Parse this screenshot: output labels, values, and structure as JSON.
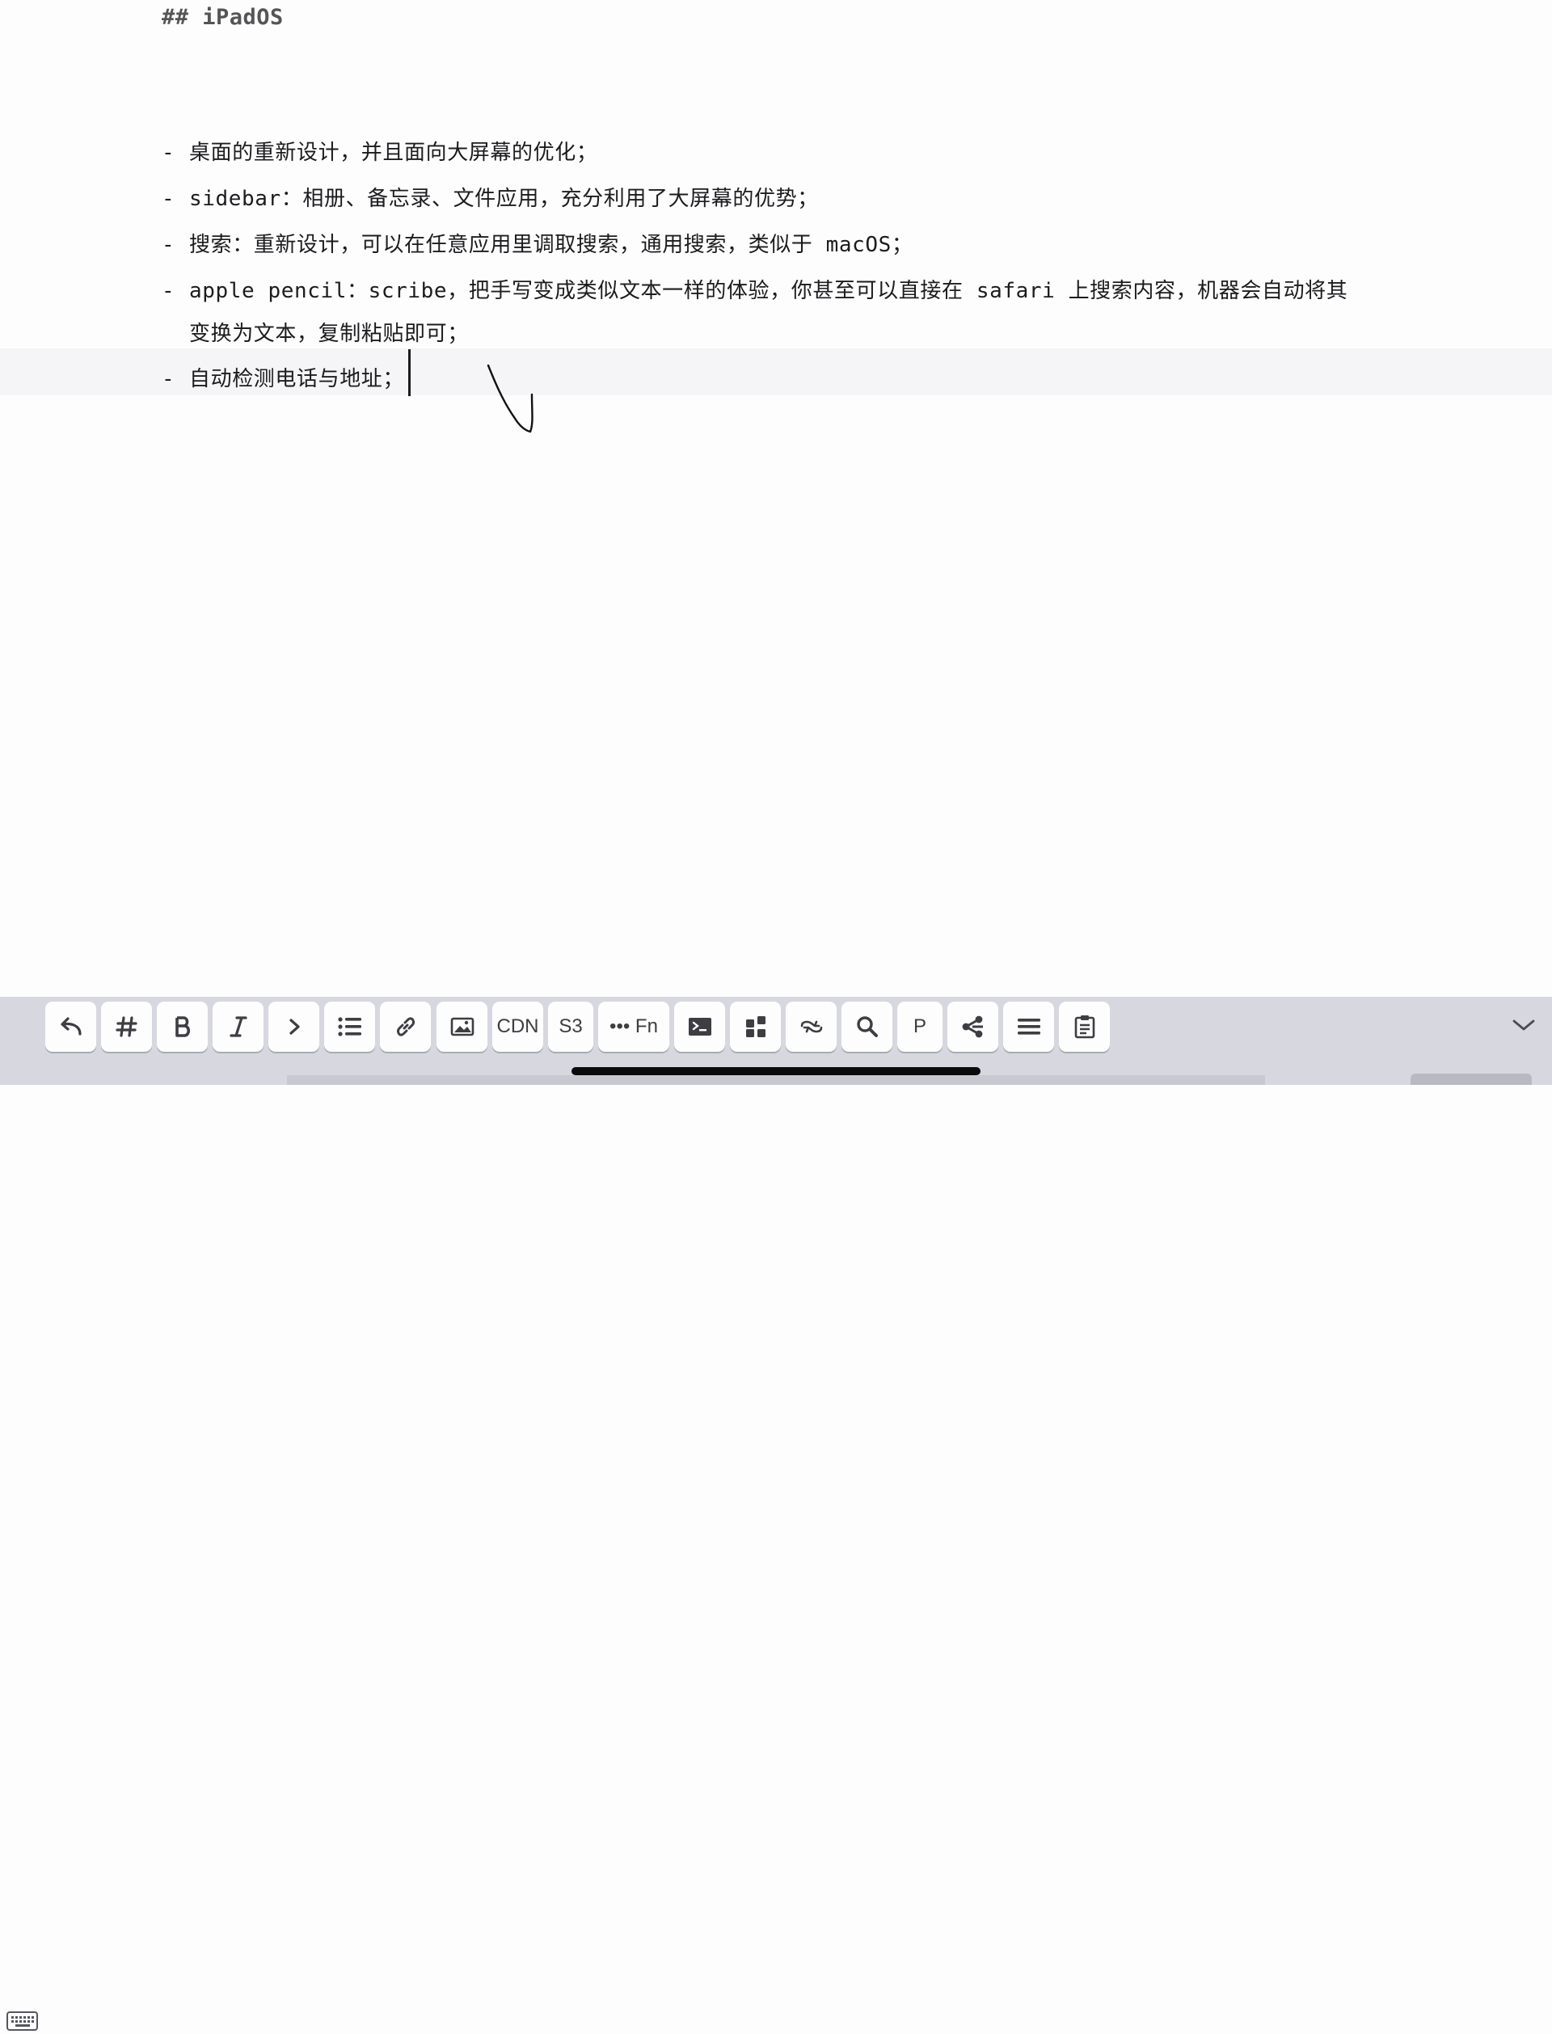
{
  "editor": {
    "heading": "## iPadOS",
    "bullet": "-",
    "items": [
      "桌面的重新设计，并且面向大屏幕的优化；",
      "sidebar：相册、备忘录、文件应用，充分利用了大屏幕的优势；",
      "搜索：重新设计，可以在任意应用里调取搜索，通用搜索，类似于 macOS；",
      "apple pencil：scribe，把手写变成类似文本一样的体验，你甚至可以直接在 safari 上搜索内容，机器会自动将其",
      "变换为文本，复制粘贴即可；",
      "自动检测电话与地址；"
    ]
  },
  "toolbar": {
    "cdn_label": "CDN",
    "s3_label": "S3",
    "fn_label": "••• Fn",
    "p_label": "P",
    "buttons": [
      "undo-icon",
      "hash-icon",
      "bold-icon",
      "italic-icon",
      "quote-icon",
      "list-icon",
      "link-icon",
      "image-icon",
      "cdn",
      "s3",
      "fn",
      "terminal-icon",
      "grid-icon",
      "cycle-icon",
      "search-icon",
      "p",
      "share-icon",
      "menu-icon",
      "clipboard-icon"
    ]
  },
  "colors": {
    "page_bg": "#fefdfe",
    "toolbar_bg": "#d7d8df",
    "button_bg": "#fdfdfe",
    "text": "#1c1c1e"
  }
}
